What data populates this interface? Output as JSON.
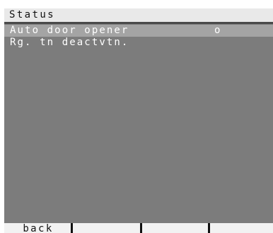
{
  "header": {
    "title": "Status"
  },
  "menu": {
    "items": [
      {
        "label": "Auto door opener",
        "value": "o",
        "selected": true
      },
      {
        "label": "Rg. tn deactvtn.",
        "value": "",
        "selected": false
      }
    ]
  },
  "softkeys": {
    "key1": "back",
    "key2": "",
    "key3": "",
    "key4": ""
  },
  "colors": {
    "background": "#7c7c7c",
    "title_bar": "#e9e9e9",
    "selection": "#a4a4a4",
    "softkey_bar": "#f2f2f2",
    "text_light": "#ffffff",
    "text_dark": "#111111"
  }
}
